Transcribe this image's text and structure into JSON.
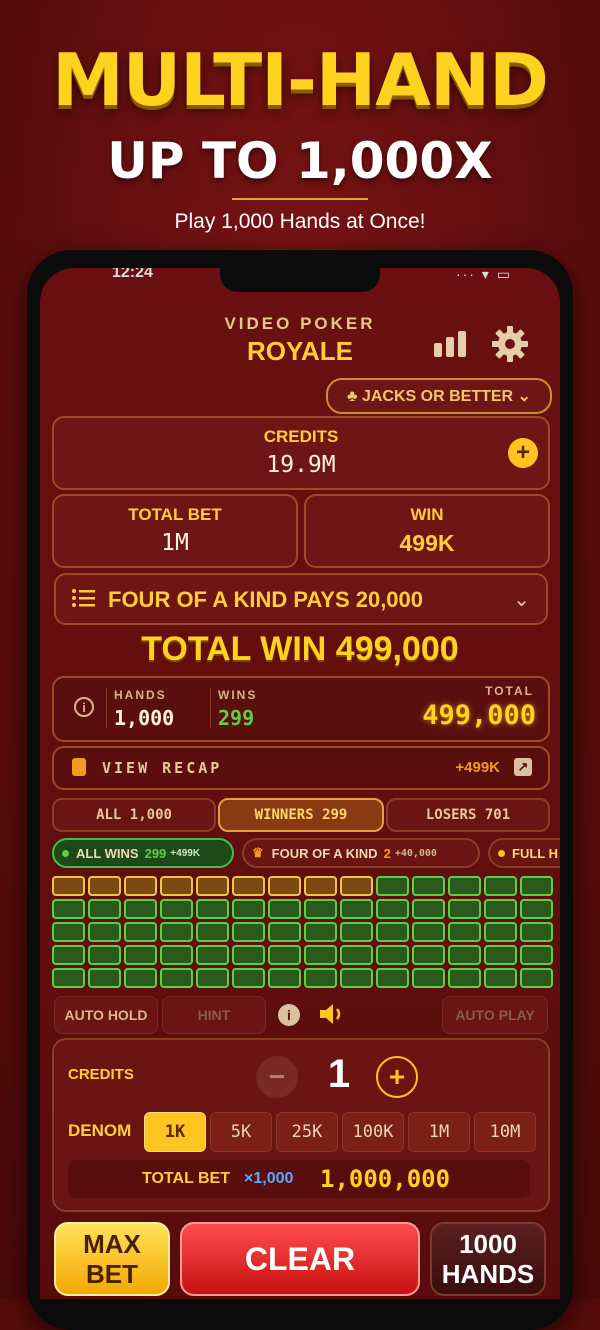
{
  "promo": {
    "title": "MULTI-HAND",
    "subtitle": "UP TO 1,000X",
    "tagline": "Play 1,000 Hands at Once!"
  },
  "status": {
    "time": "12:24",
    "icons": "··· ▾ ▭"
  },
  "header": {
    "logo_top": "VIDEO POKER",
    "logo_main": "ROYALE",
    "icons": [
      "stats-icon",
      "gear-icon"
    ],
    "game_select": "♣ JACKS OR BETTER ⌄"
  },
  "credits": {
    "label": "CREDITS",
    "value": "19.9M"
  },
  "total_bet": {
    "label": "TOTAL BET",
    "value": "1M"
  },
  "win": {
    "label": "WIN",
    "value": "499K"
  },
  "paytable": {
    "text": "FOUR OF A KIND PAYS 20,000"
  },
  "total_win": "TOTAL WIN 499,000",
  "stats": {
    "hands_label": "HANDS",
    "hands_value": "1,000",
    "wins_label": "WINS",
    "wins_value": "299",
    "total_label": "TOTAL",
    "total_value": "499,000"
  },
  "recap": {
    "label": "VIEW RECAP",
    "amount": "+499K"
  },
  "tabs": [
    "ALL 1,000",
    "WINNERS 299",
    "LOSERS 701"
  ],
  "filters": [
    {
      "name": "ALL WINS",
      "count": "299",
      "amount": "+499K"
    },
    {
      "name": "FOUR OF A KIND",
      "count": "2",
      "amount": "+40,000"
    },
    {
      "name": "FULL H"
    }
  ],
  "controls": {
    "auto_hold": "AUTO HOLD",
    "hint": "HINT",
    "auto_play": "AUTO PLAY"
  },
  "bet": {
    "credits_label": "CREDITS",
    "credits_value": "1",
    "denom_label": "DENOM",
    "denoms": [
      "1K",
      "5K",
      "25K",
      "100K",
      "1M",
      "10M"
    ],
    "selected_denom": "1K",
    "total_bet_label": "TOTAL BET",
    "multiplier": "×1,000",
    "total_bet_value": "1,000,000"
  },
  "buttons": {
    "max_bet": "MAX BET",
    "clear": "CLEAR",
    "hands": "1000 HANDS"
  },
  "colors": {
    "gold": "#ffcf3a",
    "green": "#5ccf45",
    "red": "#e23030",
    "bg": "#5e0d0d"
  }
}
